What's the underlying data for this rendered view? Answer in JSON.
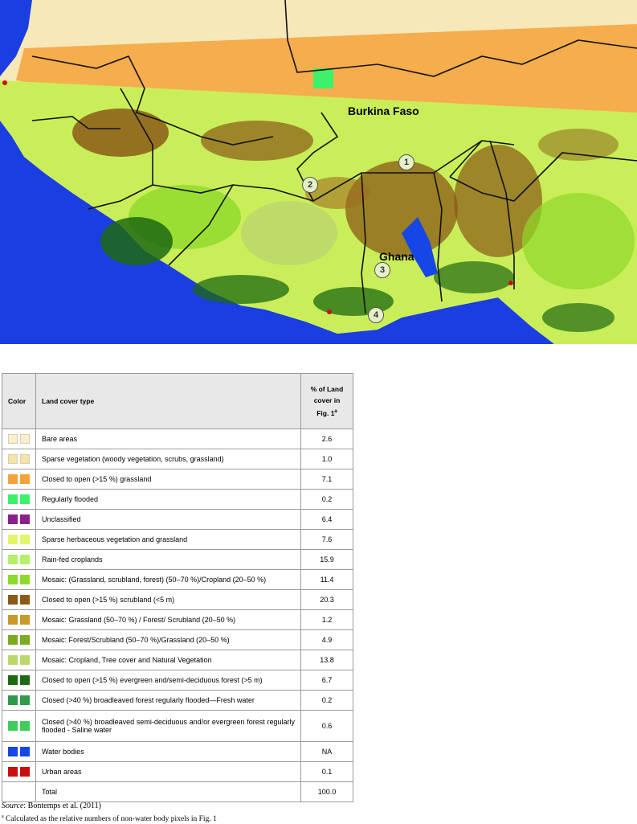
{
  "map": {
    "labels": {
      "burkina": "Burkina Faso",
      "ghana": "Ghana"
    },
    "markers": [
      "1",
      "2",
      "3",
      "4"
    ]
  },
  "table": {
    "headers": {
      "color": "Color",
      "type": "Land cover type",
      "pct_line1": "% of Land",
      "pct_line2": "cover in",
      "pct_line3": "Fig. 1",
      "pct_sup": "a"
    },
    "rows": [
      {
        "color": "#f7f0d0",
        "label": "Bare areas",
        "value": "2.6"
      },
      {
        "color": "#f5e3a8",
        "label": "Sparse vegetation (woody vegetation, scrubs, grassland)",
        "value": "1.0"
      },
      {
        "color": "#f4a23a",
        "label": "Closed to open (>15 %) grassland",
        "value": "7.1"
      },
      {
        "color": "#3ff06a",
        "label": "Regularly flooded",
        "value": "0.2"
      },
      {
        "color": "#8b1f8e",
        "label": "Unclassified",
        "value": "6.4"
      },
      {
        "color": "#e3f56a",
        "label": "Sparse herbaceous vegetation and grassland",
        "value": "7.6"
      },
      {
        "color": "#b4f06a",
        "label": "Rain-fed croplands",
        "value": "15.9"
      },
      {
        "color": "#8ed92a",
        "label": "Mosaic: (Grassland, scrubland, forest) (50–70 %)/Cropland (20–50 %)",
        "value": "11.4"
      },
      {
        "color": "#8a5a16",
        "label": "Closed to open (>15 %) scrubland (<5 m)",
        "value": "20.3"
      },
      {
        "color": "#c79a2a",
        "label": "Mosaic: Grassland (50–70 %) / Forest/ Scrubland (20–50 %)",
        "value": "1.2"
      },
      {
        "color": "#7aac22",
        "label": "Mosaic: Forest/Scrubland (50–70 %)/Grassland (20–50 %)",
        "value": "4.9"
      },
      {
        "color": "#bcd86a",
        "label": "Mosaic: Cropland, Tree cover and Natural Vegetation",
        "value": "13.8"
      },
      {
        "color": "#1e6a12",
        "label": "Closed to open (>15 %) evergreen and/semi-deciduous forest (>5 m)",
        "value": "6.7"
      },
      {
        "color": "#2f9a4a",
        "label": "Closed (>40 %) broadleaved forest regularly flooded—Fresh water",
        "value": "0.2"
      },
      {
        "color": "#3ecc5a",
        "label": "Closed (>40 %) broadleaved semi-deciduous and/or evergreen forest regularly flooded - Saline water",
        "value": "0.6"
      },
      {
        "color": "#1646e6",
        "label": "Water bodies",
        "value": "NA"
      },
      {
        "color": "#c81010",
        "label": "Urban areas",
        "value": "0.1"
      }
    ],
    "total": {
      "label": "Total",
      "value": "100.0"
    }
  },
  "source": {
    "prefix": "Source",
    "text": ": Bontemps et al. (2011)"
  },
  "footnote": {
    "mark": "a",
    "text": " Calculated as the relative numbers of non-water body pixels in Fig. 1"
  }
}
